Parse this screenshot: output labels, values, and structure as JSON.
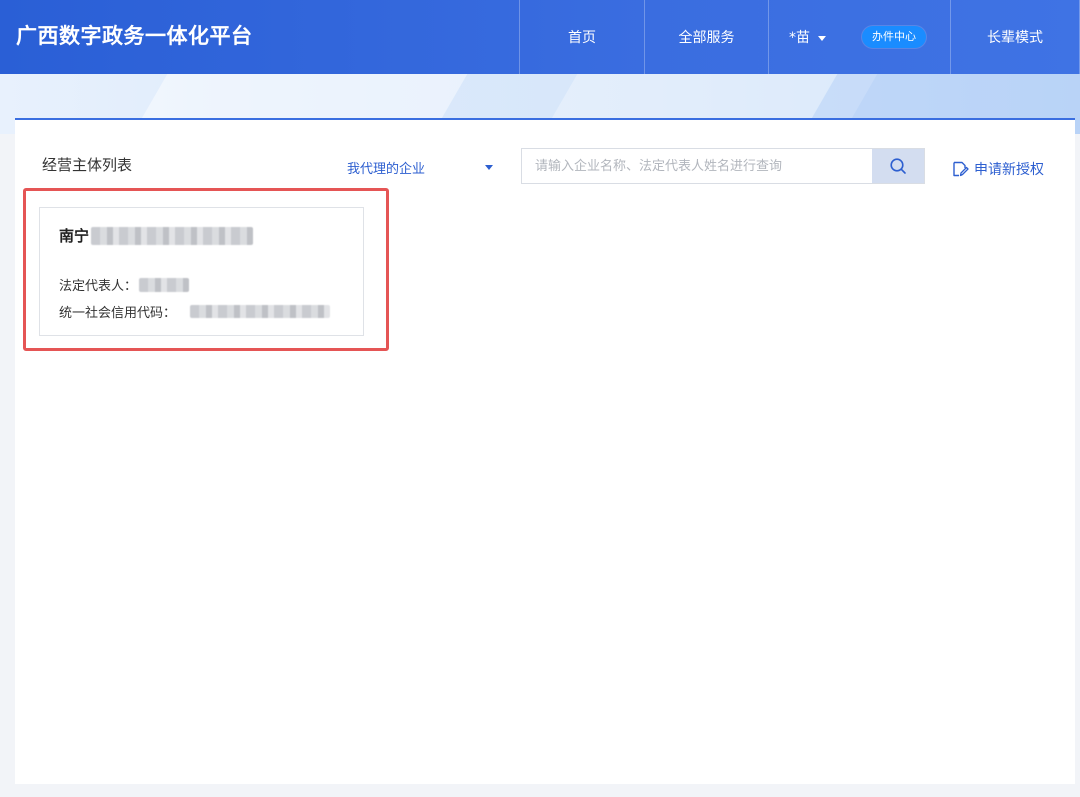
{
  "header": {
    "brand": "广西数字政务一体化平台",
    "nav": {
      "home": "首页",
      "services": "全部服务",
      "user_name": "*苗",
      "service_center_badge": "办件中心",
      "elder_mode": "长辈模式"
    }
  },
  "panel": {
    "title": "经营主体列表",
    "scope_select": {
      "selected": "我代理的企业"
    },
    "search": {
      "placeholder": "请输入企业名称、法定代表人姓名进行查询",
      "value": ""
    },
    "apply_button": "申请新授权"
  },
  "companies": [
    {
      "name_prefix": "南宁",
      "legal_rep_label": "法定代表人：",
      "credit_code_label": "统一社会信用代码："
    }
  ],
  "colors": {
    "header_blue": "#2a5fd6",
    "accent_blue": "#2d5fd0",
    "highlight_red": "#e55555",
    "badge_blue": "#1a8cff"
  },
  "icons": {
    "search": "search-icon",
    "apply": "edit-document-icon",
    "user_menu": "chevron-down-icon",
    "scope": "caret-down-icon"
  }
}
